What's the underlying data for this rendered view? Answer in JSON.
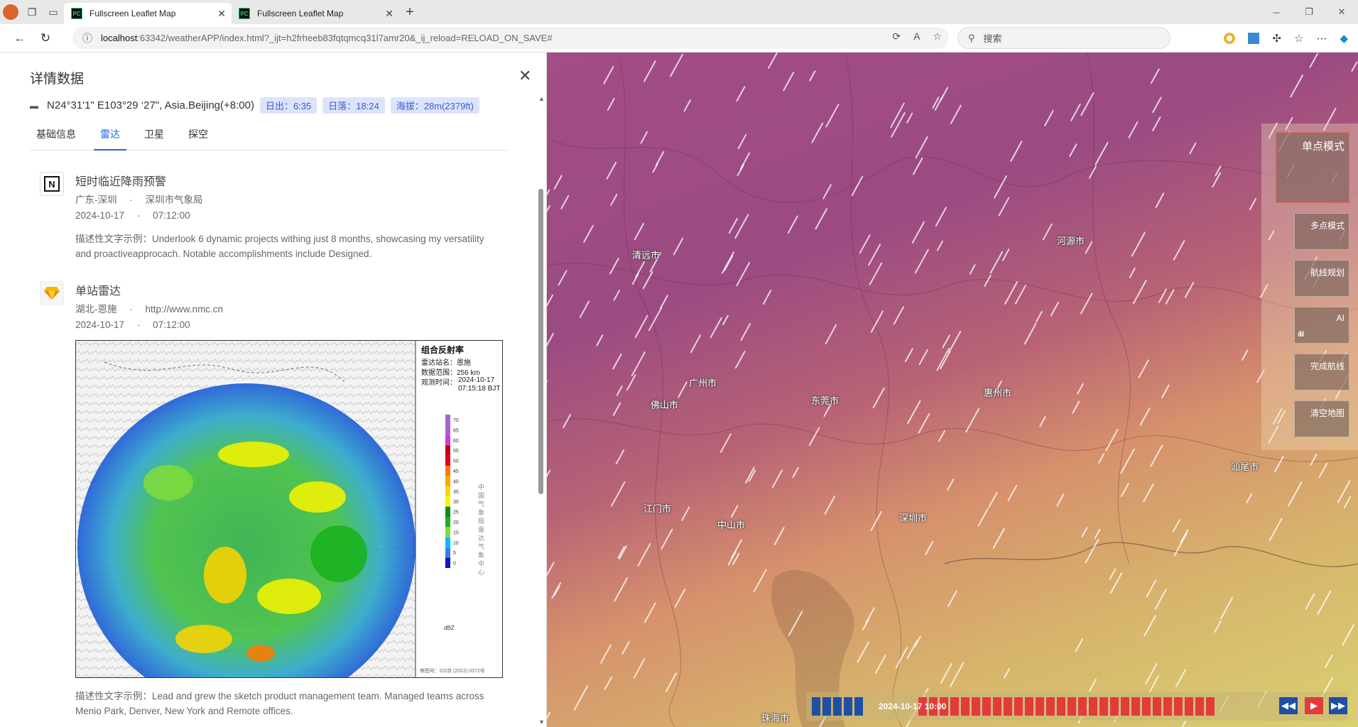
{
  "browser": {
    "tabs": [
      {
        "title": "Fullscreen Leaflet Map",
        "favicon": "PC"
      },
      {
        "title": "Fullscreen Leaflet Map",
        "favicon": "PC"
      }
    ],
    "url_host": "localhost",
    "url_rest": ":63342/weatherAPP/index.html?_ijt=h2frheeb83fqtqmcq31l7amr20&_ij_reload=RELOAD_ON_SAVE#",
    "search_placeholder": "搜索"
  },
  "panel": {
    "title": "详情数据",
    "coord": "N24°31'1\" E103°29  ‘27\", Asia.Beijing(+8:00)",
    "sunrise": "日出：6:35",
    "sunset": "日落：18:24",
    "altitude": "海拔：28m(2379ft)",
    "tabs": [
      "基础信息",
      "雷达",
      "卫星",
      "探空"
    ],
    "active_tab": "雷达",
    "items": [
      {
        "icon": "notion-icon",
        "title": "短时临近降雨预警",
        "region": "广东-深圳",
        "source": "深圳市气象局",
        "date": "2024-10-17",
        "time": "07:12:00",
        "desc": "描述性文字示例：Underlook 6 dynamic projects withing just 8 months, showcasing my versatility and proactiveapprocach. Notable accomplishments include Designed."
      },
      {
        "icon": "sketch-icon",
        "title": "单站雷达",
        "region": "湖北-恩施",
        "source": "http://www.nmc.cn",
        "date": "2024-10-17",
        "time": "07:12:00",
        "desc": "描述性文字示例：Lead and grew the sketch product management team. Managed teams across Menio Park, Denver, New York and Remote offices."
      }
    ],
    "separator": "·"
  },
  "radar": {
    "title": "组合反射率",
    "station": "雷达站名：恩施",
    "range": "数据范围：256 km",
    "obs_label": "观测时间：",
    "obs_date": "2024-10-17",
    "obs_time": "07:15:18 BJT",
    "scale": [
      "70",
      "65",
      "60",
      "55",
      "50",
      "45",
      "40",
      "35",
      "30",
      "25",
      "20",
      "15",
      "10",
      "5",
      "0"
    ],
    "scale_colors": [
      "#9b6bd4",
      "#b25bd6",
      "#d23bd4",
      "#c0001d",
      "#e60012",
      "#ff7a00",
      "#ffa500",
      "#ffd500",
      "#f8f500",
      "#0b8b1f",
      "#18b21a",
      "#7fdd3c",
      "#00bfff",
      "#3d7be8",
      "#1010d2"
    ],
    "unit": "dBZ",
    "vertical_text": "中国气象局雷达气象中心",
    "credit": "审图号：GS京 (2022) 0372号"
  },
  "map": {
    "cities": [
      "清远市",
      "河源市",
      "广州市",
      "佛山市",
      "东莞市",
      "惠州市",
      "江门市",
      "中山市",
      "深圳市",
      "汕尾市",
      "珠海市"
    ],
    "modes": [
      "单点模式",
      "多点模式",
      "航线规划",
      "AI",
      "完成航线",
      "清空地图"
    ],
    "time": "2024-10-17 10:00"
  }
}
